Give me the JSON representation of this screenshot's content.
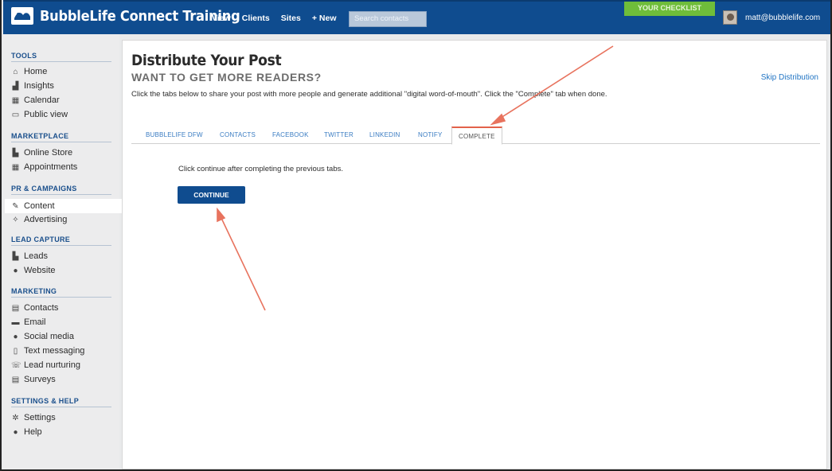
{
  "topbar": {
    "brand": "BubbleLife Connect Training",
    "nav": [
      "View",
      "Clients",
      "Sites",
      "+ New"
    ],
    "search_placeholder": "Search contacts",
    "checklist": "YOUR CHECKLIST",
    "user_email": "matt@bubblelife.com"
  },
  "sidebar": {
    "sections": [
      {
        "title": "TOOLS",
        "items": [
          {
            "label": "Home",
            "icon": "home-icon",
            "glyph": "⌂"
          },
          {
            "label": "Insights",
            "icon": "insights-icon",
            "glyph": "▟"
          },
          {
            "label": "Calendar",
            "icon": "calendar-icon",
            "glyph": "▦"
          },
          {
            "label": "Public view",
            "icon": "monitor-icon",
            "glyph": "▭"
          }
        ]
      },
      {
        "title": "MARKETPLACE",
        "items": [
          {
            "label": "Online Store",
            "icon": "store-icon",
            "glyph": "▙"
          },
          {
            "label": "Appointments",
            "icon": "appointments-icon",
            "glyph": "▦"
          }
        ]
      },
      {
        "title": "PR & CAMPAIGNS",
        "items": [
          {
            "label": "Content",
            "icon": "edit-icon",
            "glyph": "✎"
          },
          {
            "label": "Advertising",
            "icon": "advertising-icon",
            "glyph": "✧"
          }
        ]
      },
      {
        "title": "LEAD CAPTURE",
        "items": [
          {
            "label": "Leads",
            "icon": "leads-icon",
            "glyph": "▙"
          },
          {
            "label": "Website",
            "icon": "globe-icon",
            "glyph": "●"
          }
        ]
      },
      {
        "title": "MARKETING",
        "items": [
          {
            "label": "Contacts",
            "icon": "contacts-icon",
            "glyph": "▤"
          },
          {
            "label": "Email",
            "icon": "email-icon",
            "glyph": "▬"
          },
          {
            "label": "Social media",
            "icon": "social-icon",
            "glyph": "●"
          },
          {
            "label": "Text messaging",
            "icon": "phone-icon",
            "glyph": "▯"
          },
          {
            "label": "Lead nurturing",
            "icon": "nurturing-icon",
            "glyph": "☏"
          },
          {
            "label": "Surveys",
            "icon": "surveys-icon",
            "glyph": "▤"
          }
        ]
      },
      {
        "title": "SETTINGS & HELP",
        "items": [
          {
            "label": "Settings",
            "icon": "gear-icon",
            "glyph": "✲"
          },
          {
            "label": "Help",
            "icon": "help-icon",
            "glyph": "●"
          }
        ]
      }
    ]
  },
  "main": {
    "title": "Distribute Your Post",
    "subtitle": "WANT TO GET MORE READERS?",
    "skip": "Skip Distribution",
    "description": "Click the tabs below to share your post with more people and generate additional \"digital word-of-mouth\". Click the \"Complete\" tab when done.",
    "tabs": [
      "BUBBLELIFE DFW",
      "CONTACTS",
      "FACEBOOK",
      "TWITTER",
      "LINKEDIN",
      "NOTIFY",
      "COMPLETE"
    ],
    "active_tab": "COMPLETE",
    "instruction": "Click continue after completing the previous tabs.",
    "continue_label": "CONTINUE"
  },
  "colors": {
    "topbar": "#0f4c8f",
    "accent_blue": "#1a4f8c",
    "link_blue": "#2275c4",
    "checklist_green": "#6fbd3a",
    "annotation_arrow": "#e8735e"
  }
}
